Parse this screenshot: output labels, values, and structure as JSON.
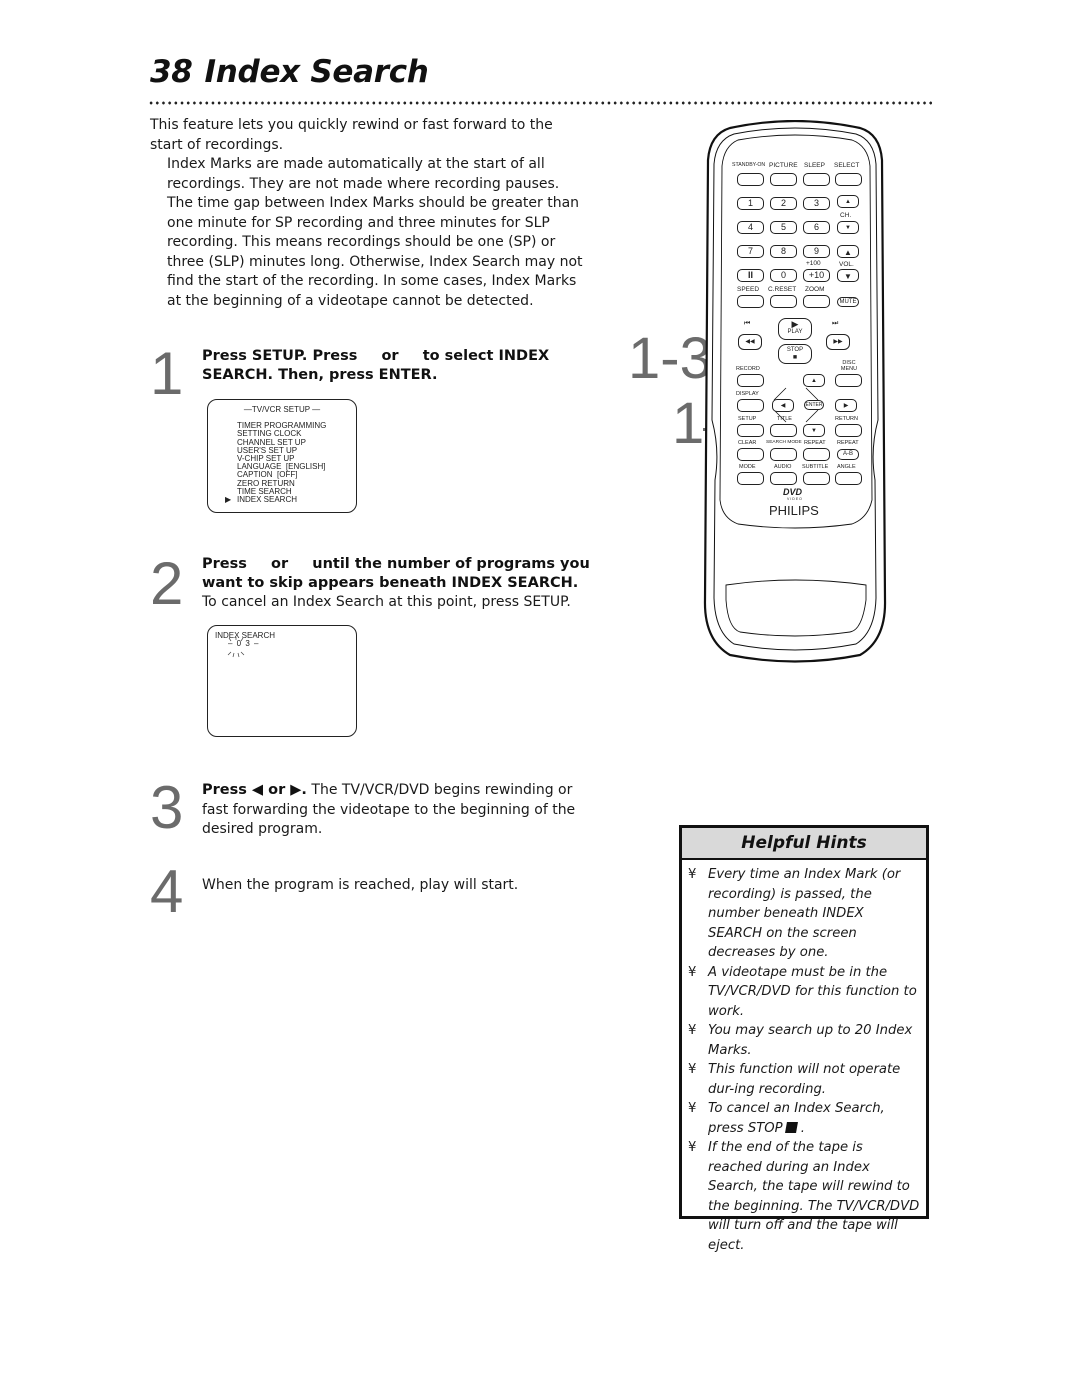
{
  "page": {
    "number": "38",
    "title": "Index Search"
  },
  "intro": {
    "p1": "This feature lets you quickly rewind or fast forward to the start of recordings.",
    "p2": "Index Marks are made automatically at the start of all recordings. They are not made where recording pauses. The time gap between Index Marks should be greater than one minute for SP recording and three minutes for SLP recording. This means recordings should be one (SP) or three (SLP) minutes long. Otherwise, Index Search may not find the start of the recording. In some cases, Index Marks at the beginning of a videotape cannot be detected."
  },
  "steps": [
    {
      "number": "1",
      "bold_a": "Press SETUP. Press",
      "bold_or": "or",
      "bold_b": "to select INDEX SEARCH. Then, press ENTER."
    },
    {
      "number": "2",
      "bold_a": "Press",
      "bold_or": "or",
      "bold_b": "until the number of programs you want to skip appears beneath INDEX SEARCH.",
      "regular": "To cancel an Index Search at this point, press SETUP."
    },
    {
      "number": "3",
      "bold": "Press ◀ or ▶.",
      "regular": "The TV/VCR/DVD begins rewinding or fast forwarding the videotape to the beginning of the desired program."
    },
    {
      "number": "4",
      "regular": "When the program is reached, play will start."
    }
  ],
  "osd_setup": {
    "title": "—TV/VCR SETUP —",
    "cursor": "▶",
    "items": [
      "TIMER PROGRAMMING",
      "SETTING CLOCK",
      "CHANNEL SET UP",
      "USER'S SET UP",
      "V-CHIP SET UP",
      "LANGUAGE  [ENGLISH]",
      "CAPTION  [OFF]",
      "ZERO RETURN",
      "TIME SEARCH",
      "INDEX SEARCH"
    ],
    "selected_index": 9
  },
  "osd_index": {
    "label": "INDEX SEARCH",
    "count": "– 0 3 –"
  },
  "callouts": {
    "a": "1-3",
    "b": "1"
  },
  "remote": {
    "row1_labels": [
      "STANDBY-ON",
      "PICTURE",
      "SLEEP",
      "SELECT"
    ],
    "digits": [
      "1",
      "2",
      "3",
      "4",
      "5",
      "6",
      "7",
      "8",
      "9"
    ],
    "pause": "II",
    "zero": "0",
    "plus10": "+10",
    "plus100": "+100",
    "ch_label": "CH.",
    "vol_label": "VOL.",
    "row_speed_labels": [
      "SPEED",
      "C.RESET",
      "ZOOM"
    ],
    "mute": "MUTE",
    "play": "PLAY",
    "stop": "STOP",
    "record": "RECORD",
    "disc_menu": "DISC MENU",
    "display": "DISPLAY",
    "enter": "ENTER",
    "setup": "SETUP",
    "title": "TITLE",
    "return": "RETURN",
    "row_clear_labels": [
      "CLEAR",
      "SEARCH MODE",
      "REPEAT",
      "REPEAT"
    ],
    "ab": "A-B",
    "row_mode_labels": [
      "MODE",
      "AUDIO",
      "SUBTITLE",
      "ANGLE"
    ],
    "dvd_logo": "DVD",
    "dvd_sub": "VIDEO",
    "brand": "PHILIPS"
  },
  "hints": {
    "title": "Helpful Hints",
    "bullet": "¥",
    "items": [
      "Every time an Index Mark (or recording) is passed, the number beneath INDEX SEARCH on the screen decreases by one.",
      "A videotape must be in the TV/VCR/DVD for this function to work.",
      "You may search up to 20 Index Marks.",
      "This function will not operate dur-ing recording.",
      "To cancel an Index Search, press STOP",
      "If the end of the tape is reached during an Index Search, the tape will rewind to the beginning. The TV/VCR/DVD will turn off and the tape will eject."
    ]
  }
}
